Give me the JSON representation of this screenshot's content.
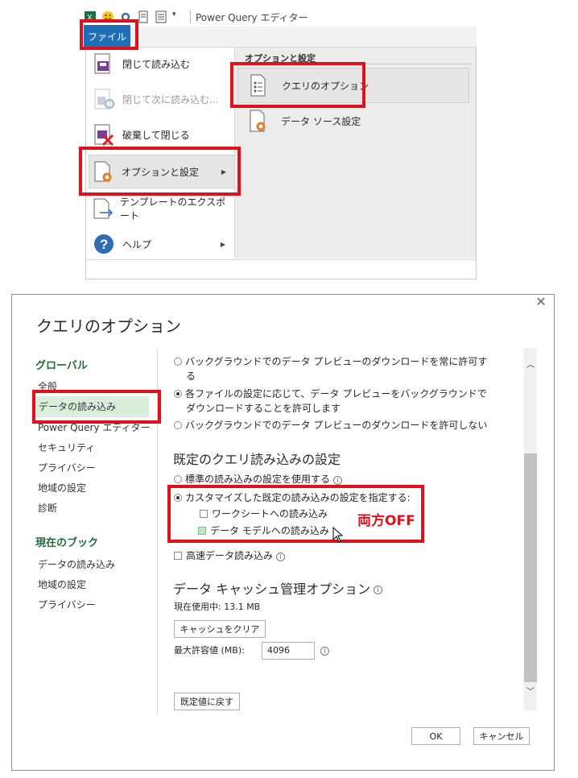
{
  "pq_window": {
    "title": "Power Query エディター",
    "file_tab": "ファイル",
    "menu_items": [
      {
        "label": "閉じて読み込む",
        "disabled": false,
        "icon": "save-load-icon"
      },
      {
        "label": "閉じて次に読み込む...",
        "disabled": true,
        "icon": "save-load-gear-icon"
      },
      {
        "label": "破棄して閉じる",
        "disabled": false,
        "icon": "discard-close-icon"
      },
      {
        "label": "オプションと設定",
        "disabled": false,
        "icon": "options-settings-icon",
        "has_submenu": true
      },
      {
        "label": "テンプレートのエクスポート",
        "disabled": false,
        "icon": "export-template-icon"
      },
      {
        "label": "ヘルプ",
        "disabled": false,
        "icon": "help-icon",
        "has_submenu": true
      }
    ],
    "submenu": {
      "header": "オプションと設定",
      "items": [
        {
          "label": "クエリのオプション",
          "icon": "query-options-icon"
        },
        {
          "label": "データ ソース設定",
          "icon": "data-source-settings-icon"
        }
      ]
    }
  },
  "dialog": {
    "title": "クエリのオプション",
    "close": "✕",
    "nav": {
      "global_head": "グローバル",
      "global_items": [
        "全般",
        "データの読み込み",
        "Power Query エディター",
        "セキュリティ",
        "プライバシー",
        "地域の設定",
        "診断"
      ],
      "workbook_head": "現在のブック",
      "workbook_items": [
        "データの読み込み",
        "地域の設定",
        "プライバシー"
      ]
    },
    "bg_preview": {
      "opt1_line1": "バックグラウンドでのデータ プレビューのダウンロードを常に許可す",
      "opt1_line2": "る",
      "opt2_line1": "各ファイルの設定に応じて、データ プレビューをバックグラウンドで",
      "opt2_line2": "ダウンロードすることを許可します",
      "opt3": "バックグラウンドでのデータ プレビューのダウンロードを許可しない"
    },
    "default_load": {
      "heading": "既定のクエリ読み込みの設定",
      "standard": "標準の読み込みの設定を使用する",
      "custom": "カスタマイズした既定の読み込みの設定を指定する:",
      "worksheet": "ワークシートへの読み込み",
      "data_model": "データ モデルへの読み込み"
    },
    "fast_load": "高速データ読み込み",
    "cache": {
      "heading": "データ キャッシュ管理オプション",
      "current_usage": "現在使用中: 13.1 MB",
      "clear_button": "キャッシュをクリア",
      "max_label": "最大許容値 (MB):",
      "max_value": "4096"
    },
    "reset_button": "既定値に戻す",
    "ok_button": "OK",
    "cancel_button": "キャンセル",
    "annotation": "両方OFF"
  },
  "colors": {
    "highlight_red": "#e0111b",
    "file_tab_blue": "#1f6fb8",
    "nav_green": "#1f6a3b",
    "nav_selected_bg": "#d9efdc"
  }
}
